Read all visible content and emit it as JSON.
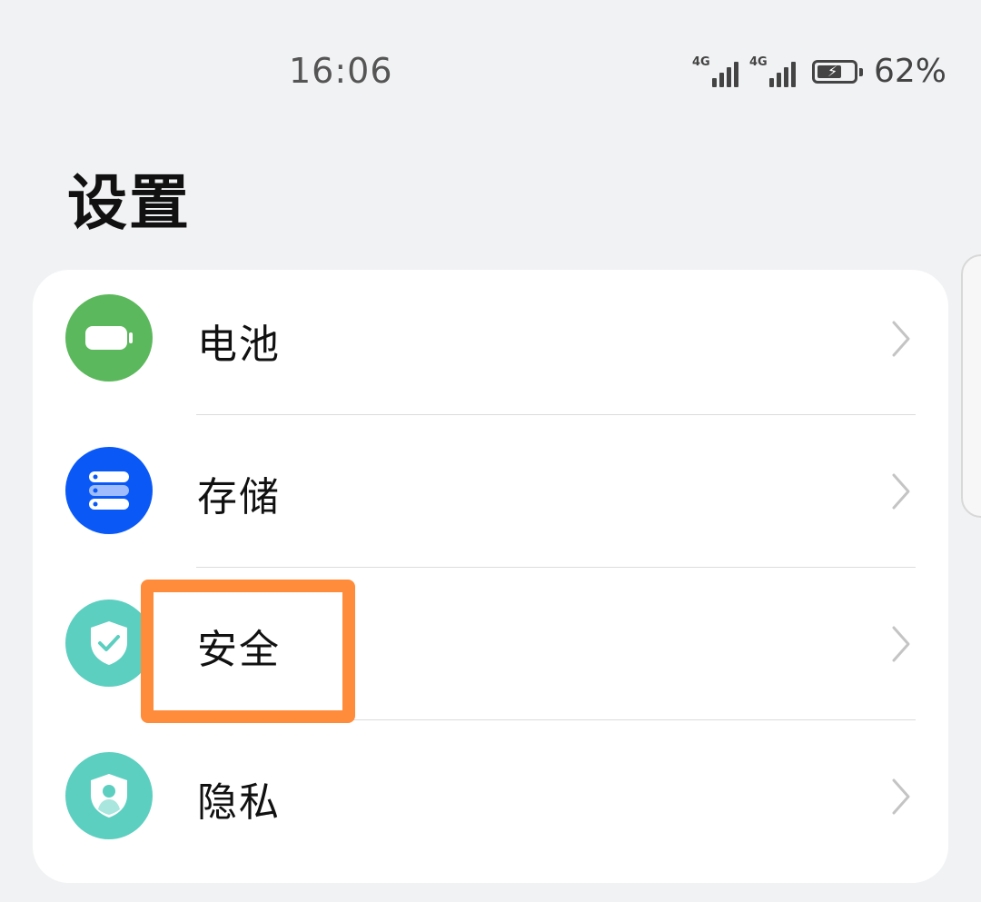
{
  "status_bar": {
    "time": "16:06",
    "signal1_tag": "4G",
    "signal2_tag": "4G",
    "battery_percent": "62%",
    "battery_charging": true
  },
  "page": {
    "title": "设置"
  },
  "settings": {
    "items": [
      {
        "label": "电池",
        "icon": "battery-icon",
        "color": "#5cb85c"
      },
      {
        "label": "存储",
        "icon": "storage-icon",
        "color": "#0a59f7"
      },
      {
        "label": "安全",
        "icon": "security-shield-icon",
        "color": "#5ccfc0"
      },
      {
        "label": "隐私",
        "icon": "privacy-shield-icon",
        "color": "#5ccfc0"
      }
    ]
  },
  "highlight": {
    "target": "安全",
    "color": "#ff8c3a"
  }
}
